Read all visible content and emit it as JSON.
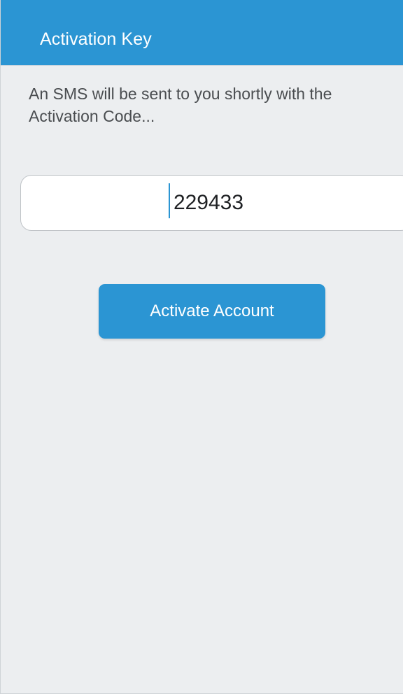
{
  "app_bar": {
    "title": "Activation Key",
    "color": "#2b95d3"
  },
  "info": {
    "message": "An SMS will be sent to you shortly with the Activation Code..."
  },
  "key_input": {
    "value": "229433"
  },
  "activate": {
    "label": "Activate Account",
    "color": "#2b95d3"
  }
}
